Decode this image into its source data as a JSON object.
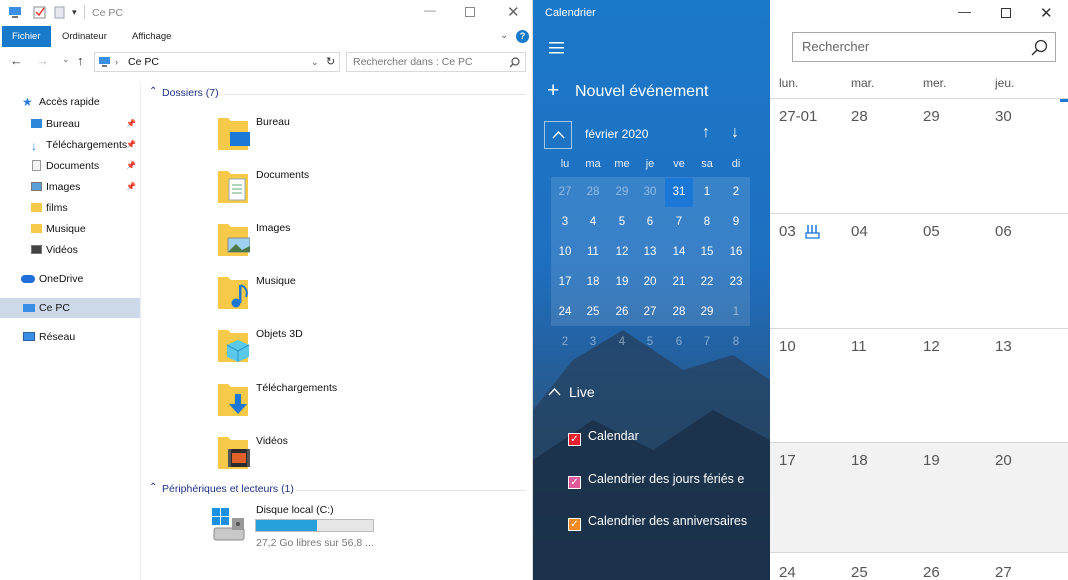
{
  "explorer": {
    "title": "Ce PC",
    "tabs": [
      "Fichier",
      "Ordinateur",
      "Affichage"
    ],
    "address": "Ce PC",
    "search_placeholder": "Rechercher dans : Ce PC",
    "nav": {
      "quick_access": "Accès rapide",
      "quick_items": [
        "Bureau",
        "Téléchargements",
        "Documents",
        "Images",
        "films",
        "Musique",
        "Vidéos"
      ],
      "onedrive": "OneDrive",
      "this_pc": "Ce PC",
      "network": "Réseau"
    },
    "folders_header": "Dossiers (7)",
    "folders": [
      "Bureau",
      "Documents",
      "Images",
      "Musique",
      "Objets 3D",
      "Téléchargements",
      "Vidéos"
    ],
    "devices_header": "Périphériques et lecteurs (1)",
    "drive": {
      "name": "Disque local (C:)",
      "free_text": "27,2 Go libres sur 56,8 ...",
      "used_fraction": 0.52
    }
  },
  "calendar": {
    "app_title": "Calendrier",
    "new_event": "Nouvel événement",
    "month_title": "février 2020",
    "weekdays": [
      "lu",
      "ma",
      "me",
      "je",
      "ve",
      "sa",
      "di"
    ],
    "weeks": [
      [
        "27",
        "28",
        "29",
        "30",
        "31",
        "1",
        "2"
      ],
      [
        "3",
        "4",
        "5",
        "6",
        "7",
        "8",
        "9"
      ],
      [
        "10",
        "11",
        "12",
        "13",
        "14",
        "15",
        "16"
      ],
      [
        "17",
        "18",
        "19",
        "20",
        "21",
        "22",
        "23"
      ],
      [
        "24",
        "25",
        "26",
        "27",
        "28",
        "29",
        "1"
      ],
      [
        "2",
        "3",
        "4",
        "5",
        "6",
        "7",
        "8"
      ]
    ],
    "today": "31",
    "account": "Live",
    "calendars": [
      {
        "name": "Calendar",
        "color": "#e8212e"
      },
      {
        "name": "Calendrier des jours fériés e",
        "color": "#e05a9b"
      },
      {
        "name": "Calendrier des anniversaires",
        "color": "#f08a24"
      }
    ]
  },
  "month_view": {
    "search_placeholder": "Rechercher",
    "columns": [
      "lun.",
      "mar.",
      "mer.",
      "jeu."
    ],
    "rows": [
      [
        "27-01",
        "28",
        "29",
        "30"
      ],
      [
        "03",
        "04",
        "05",
        "06"
      ],
      [
        "10",
        "11",
        "12",
        "13"
      ],
      [
        "17",
        "18",
        "19",
        "20"
      ],
      [
        "24",
        "25",
        "26",
        "27"
      ]
    ]
  }
}
